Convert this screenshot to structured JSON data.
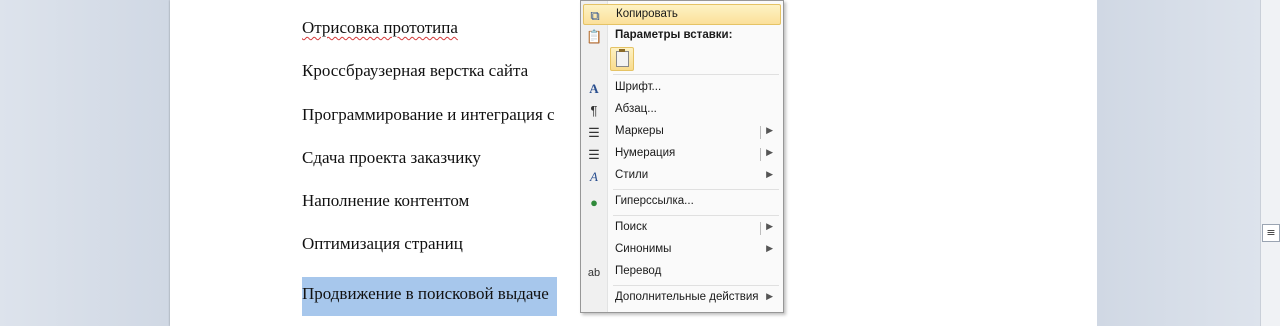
{
  "document": {
    "lines": [
      "Отрисовка прототипа",
      "Кроссбраузерная верстка сайта",
      "Программирование и интеграция с",
      "Сдача проекта заказчику",
      "Наполнение контентом",
      "Оптимизация страниц",
      "Продвижение в поисковой выдаче"
    ]
  },
  "context_menu": {
    "copy": "Копировать",
    "paste_options": "Параметры вставки:",
    "font": "Шрифт...",
    "paragraph": "Абзац...",
    "bullets": "Маркеры",
    "numbering": "Нумерация",
    "styles": "Стили",
    "hyperlink": "Гиперссылка...",
    "search": "Поиск",
    "synonyms": "Синонимы",
    "translate": "Перевод",
    "more_actions": "Дополнительные действия"
  }
}
